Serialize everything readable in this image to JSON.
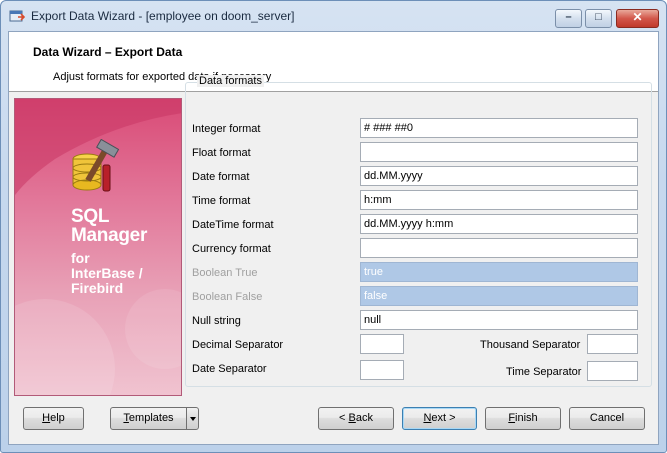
{
  "window": {
    "title": "Export Data Wizard - [employee on doom_server]",
    "controls": {
      "minimize": "–",
      "maximize": "□",
      "close": "✕"
    }
  },
  "header": {
    "title": "Data Wizard – Export Data",
    "subtitle": "Adjust formats for exported data if necessary"
  },
  "brand": {
    "line1": "SQL",
    "line2": "Manager",
    "line3": "for",
    "line4": "InterBase /",
    "line5": "Firebird"
  },
  "formats": {
    "legend": "Data formats",
    "integer": {
      "label": "Integer format",
      "value": "# ### ##0"
    },
    "float": {
      "label": "Float format",
      "value": ""
    },
    "date": {
      "label": "Date format",
      "value": "dd.MM.yyyy"
    },
    "time": {
      "label": "Time format",
      "value": "h:mm"
    },
    "datetime": {
      "label": "DateTime format",
      "value": "dd.MM.yyyy h:mm"
    },
    "currency": {
      "label": "Currency format",
      "value": ""
    },
    "bool_true": {
      "label": "Boolean True",
      "value": "true",
      "disabled": true
    },
    "bool_false": {
      "label": "Boolean False",
      "value": "false",
      "disabled": true
    },
    "null_string": {
      "label": "Null string",
      "value": "null"
    },
    "decimal_sep": {
      "label": "Decimal Separator",
      "value": ""
    },
    "thousand_sep": {
      "label": "Thousand Separator",
      "value": ""
    },
    "date_sep": {
      "label": "Date Separator",
      "value": ""
    },
    "time_sep": {
      "label": "Time Separator",
      "value": ""
    }
  },
  "buttons": {
    "help": {
      "pre": "",
      "u": "H",
      "post": "elp"
    },
    "templates": {
      "pre": "",
      "u": "T",
      "post": "emplates"
    },
    "back": {
      "pre": "< ",
      "u": "B",
      "post": "ack"
    },
    "next": {
      "pre": "",
      "u": "N",
      "post": "ext >"
    },
    "finish": {
      "pre": "",
      "u": "F",
      "post": "inish"
    },
    "cancel": {
      "pre": "",
      "u": "",
      "post": "Cancel"
    }
  },
  "icons": {
    "app": "database-export-icon",
    "brand": "database-tools-icon",
    "dropdown": "chevron-down-icon"
  },
  "colors": {
    "brand_top": "#d94a76",
    "brand_bottom": "#f0c3d0",
    "disabled_input": "#afc8e6",
    "default_button_border": "#3c7fb1"
  }
}
